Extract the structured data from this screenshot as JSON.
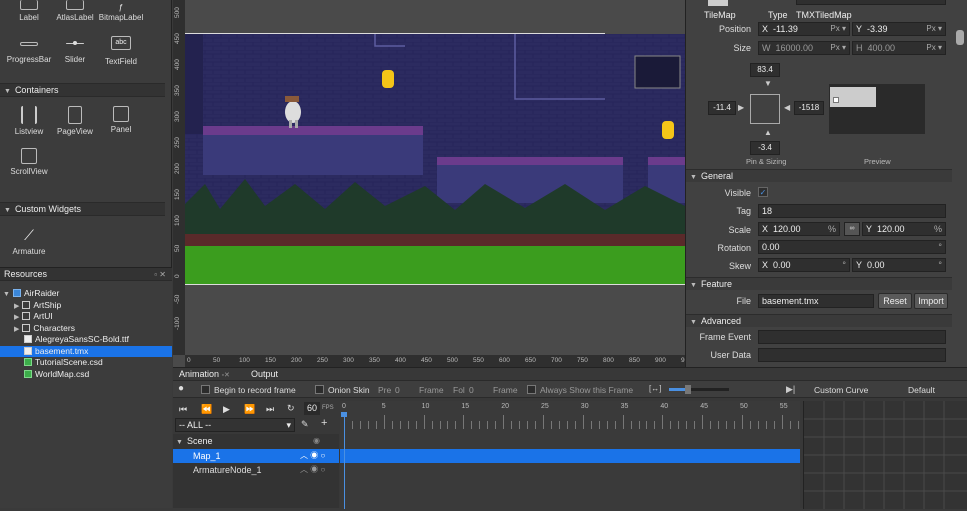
{
  "widgets_top": [
    {
      "label": "Label",
      "icon": "label-icon"
    },
    {
      "label": "AtlasLabel",
      "icon": "atlas-label-icon"
    },
    {
      "label": "BitmapLabel",
      "icon": "bitmap-label-icon"
    }
  ],
  "widgets_row2": [
    {
      "label": "ProgressBar",
      "icon": "progressbar-icon"
    },
    {
      "label": "Slider",
      "icon": "slider-icon"
    },
    {
      "label": "TextField",
      "icon": "textfield-icon",
      "glyph": "abc"
    }
  ],
  "containers": {
    "title": "Containers",
    "items": [
      {
        "label": "Listview",
        "icon": "listview-icon"
      },
      {
        "label": "PageView",
        "icon": "pageview-icon"
      },
      {
        "label": "Panel",
        "icon": "panel-icon"
      },
      {
        "label": "ScrollView",
        "icon": "scrollview-icon"
      }
    ]
  },
  "custom": {
    "title": "Custom Widgets",
    "items": [
      {
        "label": "Armature",
        "icon": "armature-icon"
      }
    ]
  },
  "resources": {
    "title": "Resources",
    "tree": [
      {
        "label": "AirRaider",
        "depth": 0,
        "kind": "project"
      },
      {
        "label": "ArtShip",
        "depth": 1,
        "kind": "folder"
      },
      {
        "label": "ArtUI",
        "depth": 1,
        "kind": "folder"
      },
      {
        "label": "Characters",
        "depth": 1,
        "kind": "folder"
      },
      {
        "label": "AlegreyaSansSC-Bold.ttf",
        "depth": 1,
        "kind": "file"
      },
      {
        "label": "basement.tmx",
        "depth": 1,
        "kind": "file",
        "selected": true
      },
      {
        "label": "TutorialScene.csd",
        "depth": 1,
        "kind": "csd"
      },
      {
        "label": "WorldMap.csd",
        "depth": 1,
        "kind": "csd"
      }
    ]
  },
  "rulers": {
    "left": [
      "500",
      "450",
      "400",
      "350",
      "300",
      "250",
      "200",
      "150",
      "100",
      "50",
      "0",
      "-50",
      "-100"
    ],
    "bottom": [
      "0",
      "50",
      "100",
      "150",
      "200",
      "250",
      "300",
      "350",
      "400",
      "450",
      "500",
      "550",
      "600",
      "650",
      "700",
      "750",
      "800",
      "850",
      "900",
      "950"
    ]
  },
  "props": {
    "widget_name": "TileMap",
    "type_label": "Type",
    "type_value": "TMXTiledMap",
    "position_label": "Position",
    "pos_x": "-11.39",
    "pos_y": "-3.39",
    "px": "Px",
    "size_label": "Size",
    "size_w": "16000.00",
    "size_h": "400.00",
    "pin_top": "83.4",
    "pin_left": "-11.4",
    "pin_right": "-1518",
    "pin_bottom": "-3.4",
    "pin_caption": "Pin & Sizing",
    "preview_caption": "Preview",
    "general": "General",
    "visible_label": "Visible",
    "visible_mark": "✓",
    "tag_label": "Tag",
    "tag_value": "18",
    "scale_label": "Scale",
    "scale_x": "120.00",
    "scale_y": "120.00",
    "pct": "%",
    "rotation_label": "Rotation",
    "rotation_value": "0.00",
    "deg": "°",
    "skew_label": "Skew",
    "skew_x": "0.00",
    "skew_y": "0.00",
    "feature": "Feature",
    "file_label": "File",
    "file_value": "basement.tmx",
    "reset": "Reset",
    "import": "Import",
    "advanced": "Advanced",
    "frame_event": "Frame Event",
    "user_data": "User Data",
    "x": "X",
    "y": "Y",
    "w": "W",
    "h": "H"
  },
  "anim": {
    "tab1": "Animation",
    "tab2": "Output",
    "record": "Begin to record frame",
    "onion": "Onion Skin",
    "pre": "Pre",
    "pre_val": "0",
    "frame": "Frame",
    "fol": "Fol",
    "fol_val": "0",
    "always": "Always Show this Frame",
    "custom_curve": "Custom Curve",
    "default": "Default",
    "fps": "60",
    "fps_label": "FPS",
    "all": "-- ALL --",
    "frames": [
      "0",
      "5",
      "10",
      "15",
      "20",
      "25",
      "30",
      "35",
      "40",
      "45",
      "50",
      "55"
    ],
    "scene": "Scene",
    "row1": "Map_1",
    "row2": "ArmatureNode_1"
  }
}
